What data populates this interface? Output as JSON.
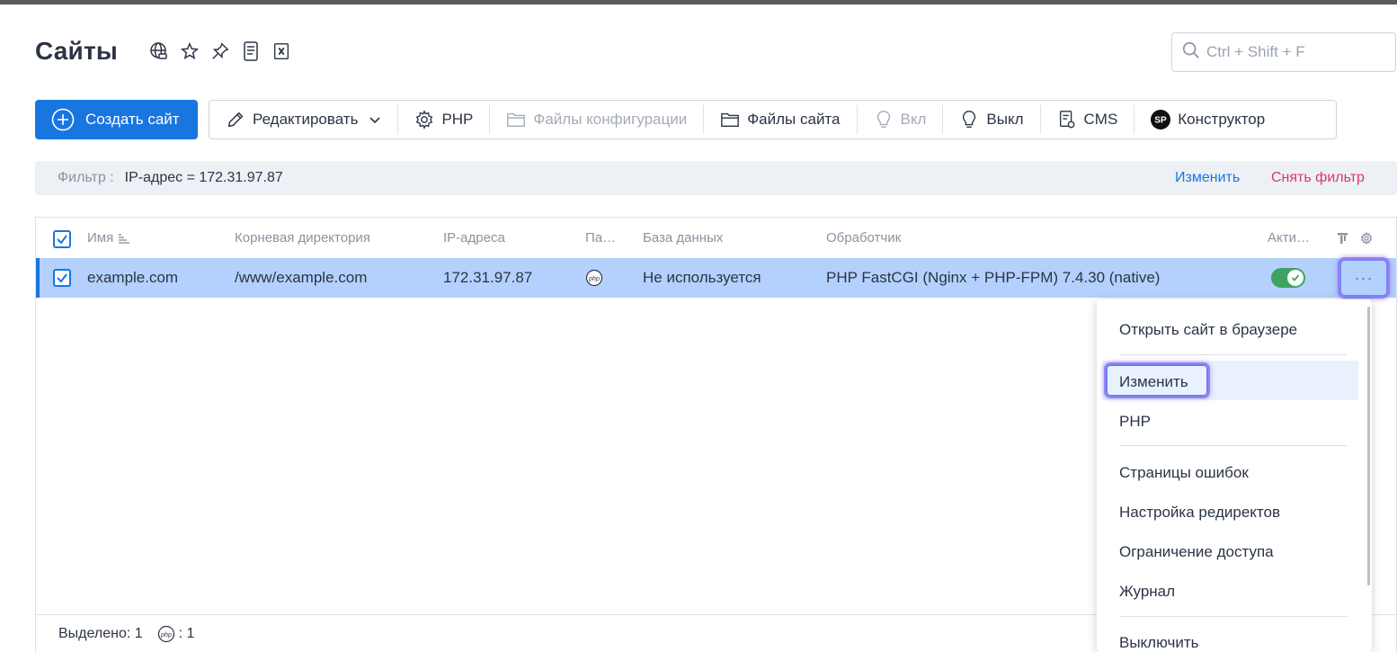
{
  "page": {
    "title": "Сайты",
    "title_icons": [
      "globe-icon",
      "star-icon",
      "pin-icon",
      "scroll-icon",
      "excel-icon"
    ]
  },
  "search": {
    "placeholder": "Ctrl + Shift + F"
  },
  "toolbar": {
    "create_label": "Создать сайт",
    "edit_label": "Редактировать",
    "php_label": "PHP",
    "config_files_label": "Файлы конфигурации",
    "site_files_label": "Файлы сайта",
    "on_label": "Вкл",
    "off_label": "Выкл",
    "cms_label": "CMS",
    "builder_label": "Конструктор",
    "builder_logo": "SP"
  },
  "filter": {
    "label": "Фильтр :",
    "value": "IP-адрес = 172.31.97.87",
    "change_label": "Изменить",
    "remove_label": "Снять фильтр"
  },
  "table": {
    "columns": [
      "Имя",
      "Корневая директория",
      "IP-адреса",
      "Па…",
      "База данных",
      "Обработчик",
      "Акти…"
    ],
    "rows": [
      {
        "name": "example.com",
        "root": "/www/example.com",
        "ip": "172.31.97.87",
        "db": "Не используется",
        "handler": "PHP FastCGI (Nginx + PHP-FPM) 7.4.30 (native)",
        "checked": true,
        "active": true,
        "more": "···"
      }
    ]
  },
  "footer": {
    "selected_label": "Выделено: 1",
    "php_count": ": 1"
  },
  "context_menu": {
    "items": [
      "Открыть сайт в браузере",
      "Изменить",
      "PHP",
      "Страницы ошибок",
      "Настройка редиректов",
      "Ограничение доступа",
      "Журнал",
      "Выключить"
    ]
  },
  "colors": {
    "accent": "#1976e0",
    "row_selected": "#b3d1fc",
    "danger_link": "#e0336e",
    "toggle_on": "#3ea361"
  }
}
